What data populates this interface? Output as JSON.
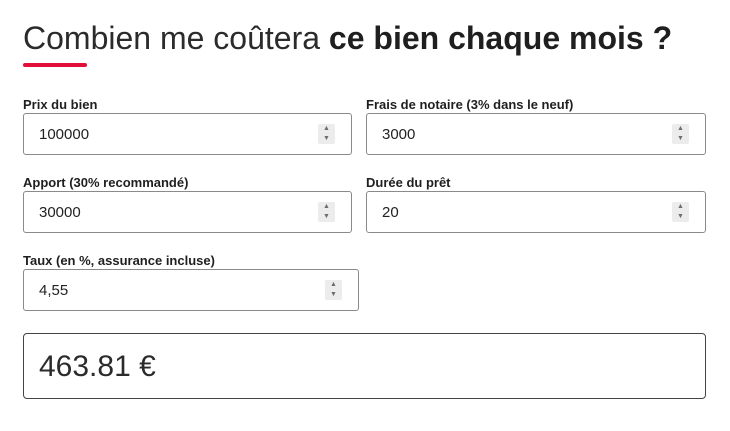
{
  "header": {
    "title_regular": "Combien me coûtera ",
    "title_bold": "ce bien chaque mois ?",
    "accent_color": "#e0103a"
  },
  "form": {
    "price": {
      "label": "Prix du bien",
      "value": "100000"
    },
    "notary_fees": {
      "label": "Frais de notaire (3% dans le neuf)",
      "value": "3000"
    },
    "down_payment": {
      "label": "Apport (30% recommandé)",
      "value": "30000"
    },
    "loan_duration": {
      "label": "Durée du prêt",
      "value": "20"
    },
    "rate": {
      "label": "Taux (en %, assurance incluse)",
      "value": "4,55"
    }
  },
  "result": {
    "monthly_payment": "463.81 €"
  },
  "icons": {
    "spinner_up": "▲",
    "spinner_down": "▼"
  }
}
